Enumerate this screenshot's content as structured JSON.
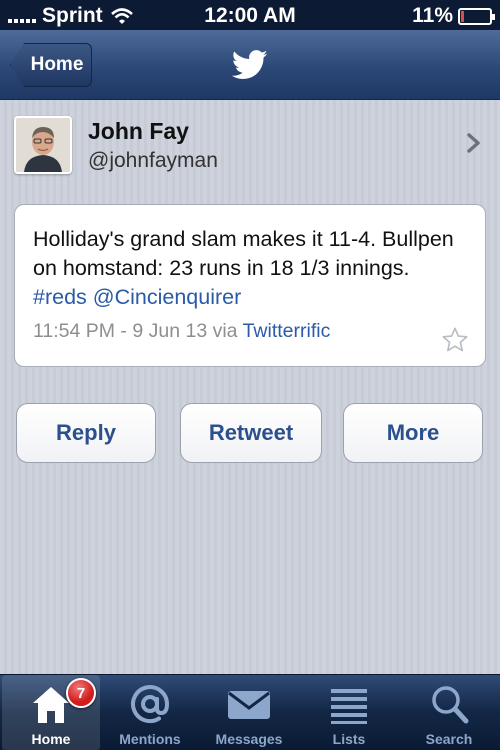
{
  "status_bar": {
    "carrier": "Sprint",
    "time": "12:00 AM",
    "battery": "11%",
    "battery_level": 0.11,
    "battery_color": "#e24a4a"
  },
  "nav": {
    "back_label": "Home",
    "center_icon": "twitter-bird-icon"
  },
  "profile": {
    "name": "John Fay",
    "handle": "@johnfayman"
  },
  "tweet": {
    "text_plain": "Holliday's grand slam makes it 11-4. Bullpen on homstand: 23 runs in 18 1/3 innings.",
    "hashtag": "#reds",
    "mention": "@Cincienquirer",
    "timestamp": "11:54 PM - 9 Jun 13 via",
    "client": "Twitterrific",
    "link_color": "#2a5aa8"
  },
  "actions": {
    "reply": "Reply",
    "retweet": "Retweet",
    "more": "More"
  },
  "tabs": [
    {
      "label": "Home",
      "icon": "house-icon",
      "active": true,
      "badge": "7"
    },
    {
      "label": "Mentions",
      "icon": "at-icon",
      "active": false
    },
    {
      "label": "Messages",
      "icon": "envelope-icon",
      "active": false
    },
    {
      "label": "Lists",
      "icon": "list-icon",
      "active": false
    },
    {
      "label": "Search",
      "icon": "magnifier-icon",
      "active": false
    }
  ]
}
